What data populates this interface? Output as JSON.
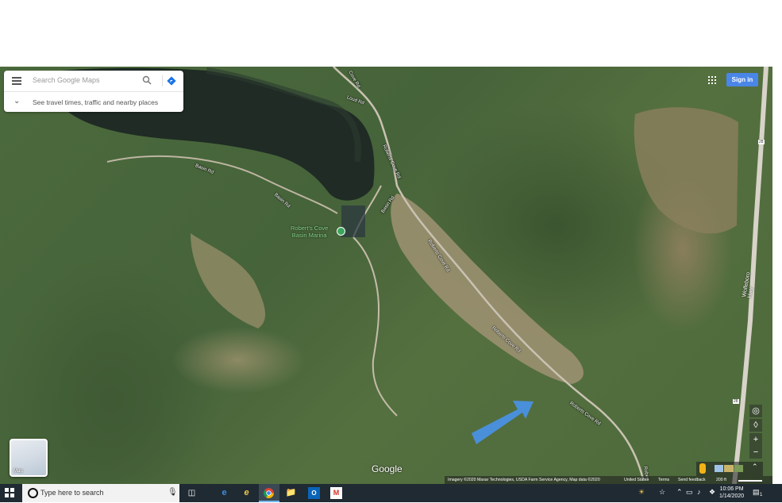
{
  "search": {
    "placeholder": "Search Google Maps",
    "travel_hint": "See travel times, traffic and nearby places"
  },
  "header": {
    "sign_in": "Sign in"
  },
  "map": {
    "labels": {
      "loud_rd": "Loud Rd",
      "cove_rd_top": "Cove Rd",
      "basin_rd_1": "Basin Rd",
      "basin_rd_2": "Basin Rd",
      "basin_rd_3": "Basin Rd",
      "roberts_cove_rd_1": "Roberts Cove Rd",
      "roberts_cove_rd_2": "Roberts Cove Rd",
      "roberts_cove_rd_3": "Roberts Cove Rd",
      "roberts_cove_rd_4": "Roberts Cove Rd",
      "roberts_bottom": "Robert",
      "wolfeboro_hwy": "Wolfeboro Hwy",
      "route_28_top": "28",
      "route_28_bottom": "28"
    },
    "poi": {
      "line1": "Robert's Cove",
      "line2": "Basin Marina"
    },
    "layer_label": "Map",
    "logo": "Google",
    "attribution": {
      "imagery": "Imagery ©2020 Maxar Technologies, USDA Farm Service Agency, Map data ©2020",
      "region": "United States",
      "terms": "Terms",
      "feedback": "Send feedback",
      "scale": "200 ft"
    }
  },
  "taskbar": {
    "search_placeholder": "Type here to search",
    "time": "10:06 PM",
    "date": "1/14/2020",
    "notif_count": "1"
  },
  "colors": {
    "accent": "#4a86e8",
    "arrow": "#4a8fd9",
    "poi": "#3ba55d",
    "taskbar": "#1f2a33"
  }
}
